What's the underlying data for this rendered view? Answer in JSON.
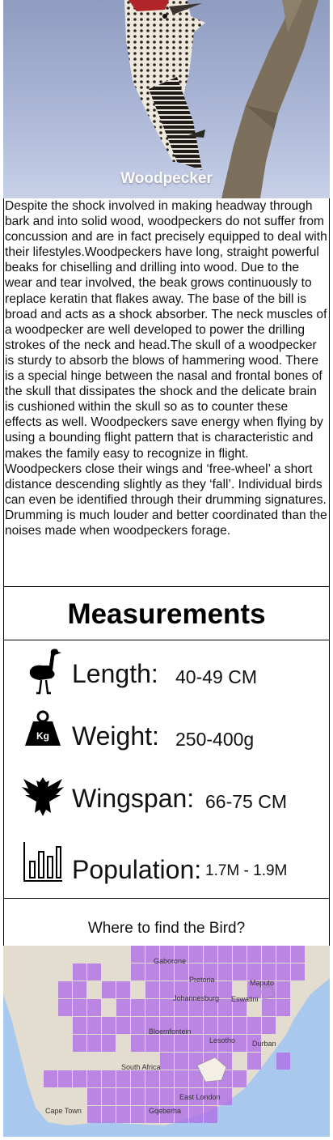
{
  "hero": {
    "title": "Woodpecker"
  },
  "description": "Despite the shock involved in making headway through bark and into solid wood, woodpeckers do not suffer from concussion and are in fact precisely equipped to deal with their lifestyles.Woodpeckers have long, straight powerful beaks for chiselling and drilling into wood. Due to the wear and tear involved, the beak grows continuously to replace keratin that flakes away. The base of the bill is broad and acts as a shock absorber. The neck muscles of a woodpecker are well developed to power the drilling strokes of the neck and head.The skull of a woodpecker is sturdy to absorb the blows of hammering wood. There is a special hinge between the nasal and frontal bones of the skull that dissipates the shock and the delicate brain is cushioned within the skull so as to counter these effects as well. Woodpeckers save energy when flying by using a bounding flight pattern that is characteristic and makes the family easy to recognize in flight. Woodpeckers close their wings and ‘free-wheel’ a short distance descending slightly as they ‘fall’.  Individual birds can even be identified through their drumming signatures. Drumming is much louder and better coordinated than the noises made when woodpeckers forage.",
  "measurements": {
    "heading": "Measurements",
    "length": {
      "label": "Length:",
      "value": "40-49 CM",
      "icon": "ostrich-icon"
    },
    "weight": {
      "label": "Weight:",
      "value": "250-400g",
      "icon": "weight-kg-icon",
      "icon_text": "Kg"
    },
    "wingspan": {
      "label": "Wingspan:",
      "value": "66-75 CM",
      "icon": "eagle-icon"
    },
    "population": {
      "label": "Population:",
      "value": "1.7M - 1.9M",
      "icon": "bar-chart-icon"
    }
  },
  "find": {
    "heading": "Where to find the Bird?"
  },
  "map": {
    "places": [
      "Gaborone",
      "Pretoria",
      "Maputo",
      "Johannesburg",
      "Eswatini",
      "Bloemfontein",
      "Lesotho",
      "Durban",
      "South Africa",
      "East London",
      "Cape Town",
      "Gqeberha"
    ],
    "colors": {
      "land": "#e3ddd0",
      "sea": "#a9c8ee",
      "range": "#b06ee8"
    }
  }
}
